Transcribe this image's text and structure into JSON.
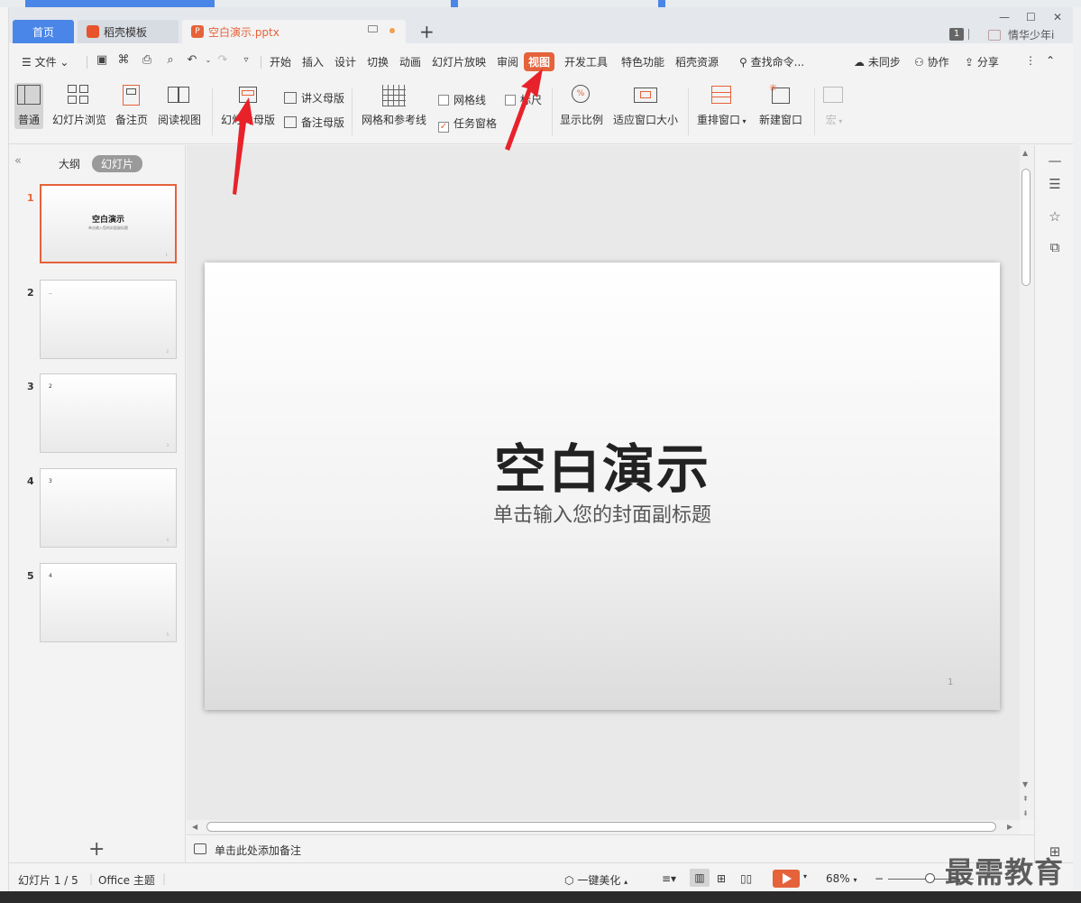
{
  "colors": {
    "accent": "#e5623a",
    "tab_home": "#4a86e8",
    "annotation_arrow": "#e8222a"
  },
  "titlebar": {
    "tabs": [
      {
        "label": "首页",
        "icon": "home"
      },
      {
        "label": "稻壳模板",
        "icon": "docer-fire-icon"
      },
      {
        "label": "空白演示.pptx",
        "icon": "ppt-file-icon",
        "unsaved": true
      }
    ],
    "new_tab": "+",
    "window_count": "1",
    "user_name": "情华少年i"
  },
  "menubar": {
    "file": "文件",
    "items": [
      "开始",
      "插入",
      "设计",
      "切换",
      "动画",
      "幻灯片放映",
      "审阅",
      "视图",
      "开发工具",
      "特色功能",
      "稻壳资源"
    ],
    "active": "视图",
    "search": "查找命令...",
    "sync": "未同步",
    "collab": "协作",
    "share": "分享"
  },
  "ribbon": {
    "normal": "普通",
    "slide_browse": "幻灯片浏览",
    "notes_page": "备注页",
    "reading_view": "阅读视图",
    "slide_master": "幻灯片母版",
    "handout_master": "讲义母版",
    "notes_master": "备注母版",
    "grid_guides": "网格和参考线",
    "gridlines": {
      "label": "网格线",
      "checked": false
    },
    "ruler": {
      "label": "标尺",
      "checked": false
    },
    "task_pane": {
      "label": "任务窗格",
      "checked": true
    },
    "zoom_ratio": "显示比例",
    "fit_window": "适应窗口大小",
    "rearrange_window": "重排窗口",
    "new_window": "新建窗口",
    "macro": "宏"
  },
  "leftpanel": {
    "outline_tab": "大纲",
    "slides_tab": "幻灯片",
    "slides": [
      {
        "num": "1",
        "title": "空白演示",
        "subtitle": "单击输入您的封面副标题",
        "current": true
      },
      {
        "num": "2",
        "mark": "..",
        "current": false
      },
      {
        "num": "3",
        "mark": "2",
        "current": false
      },
      {
        "num": "4",
        "mark": "3",
        "current": false
      },
      {
        "num": "5",
        "mark": "4",
        "current": false
      }
    ],
    "add": "+"
  },
  "slide": {
    "title": "空白演示",
    "subtitle": "单击输入您的封面副标题",
    "page_number": "1"
  },
  "notes": {
    "placeholder": "单击此处添加备注"
  },
  "status": {
    "slide_counter": "幻灯片 1 / 5",
    "theme": "Office 主题",
    "beautify": "一键美化",
    "zoom": "68%"
  },
  "watermark": "最需教育"
}
